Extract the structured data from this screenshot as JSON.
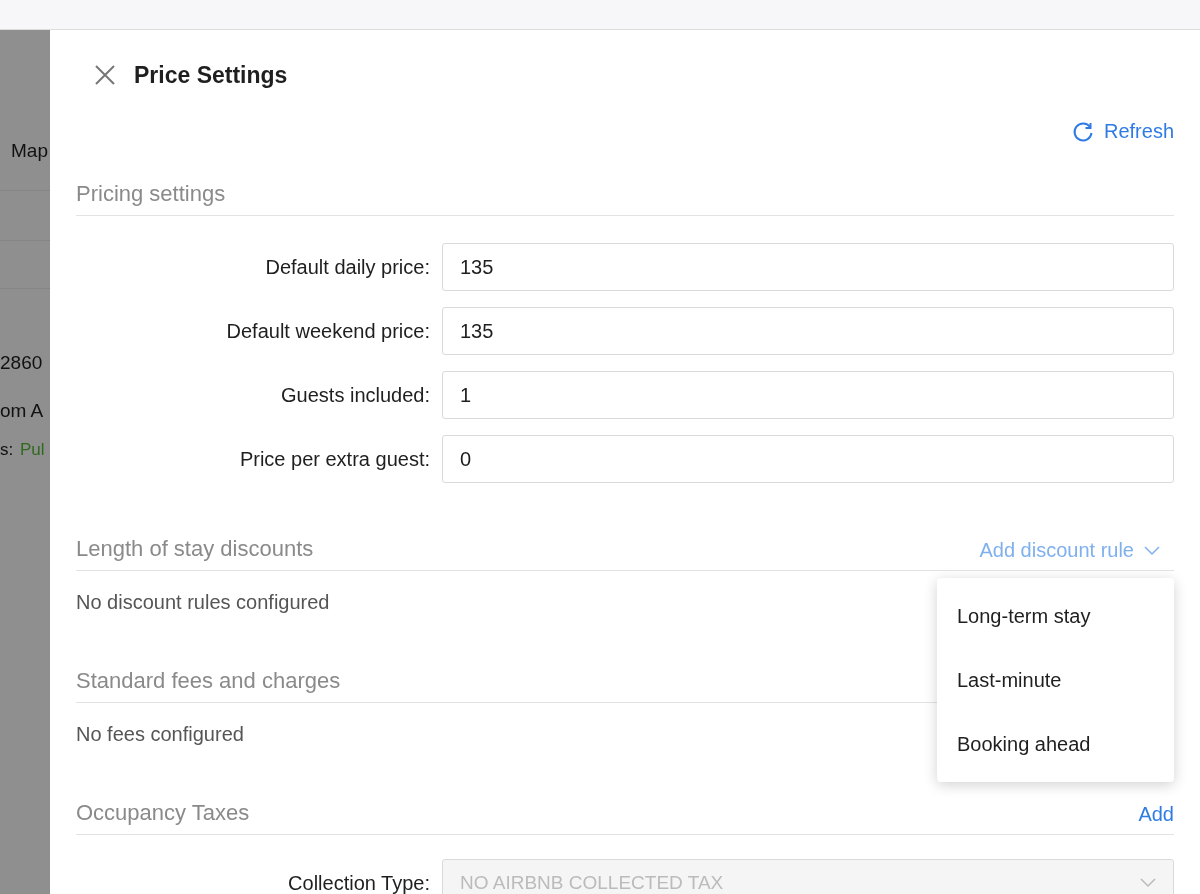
{
  "background": {
    "texts": [
      "Map",
      "2860",
      "om A"
    ],
    "status_label": "s:",
    "status_value": "Pul"
  },
  "drawer": {
    "title": "Price Settings",
    "refresh": "Refresh",
    "pricing": {
      "title": "Pricing settings",
      "fields": [
        {
          "label": "Default daily price:",
          "value": "135"
        },
        {
          "label": "Default weekend price:",
          "value": "135"
        },
        {
          "label": "Guests included:",
          "value": "1"
        },
        {
          "label": "Price per extra guest:",
          "value": "0"
        }
      ]
    },
    "discounts": {
      "title": "Length of stay discounts",
      "action": "Add discount rule",
      "expanded": true,
      "empty": "No discount rules configured",
      "menu": [
        "Long-term stay",
        "Last-minute",
        "Booking ahead"
      ]
    },
    "fees": {
      "title": "Standard fees and charges",
      "empty": "No fees configured"
    },
    "taxes": {
      "title": "Occupancy Taxes",
      "action": "Add",
      "select_label": "Collection Type:",
      "select_value": "NO AIRBNB COLLECTED TAX",
      "select_disabled": true
    }
  }
}
